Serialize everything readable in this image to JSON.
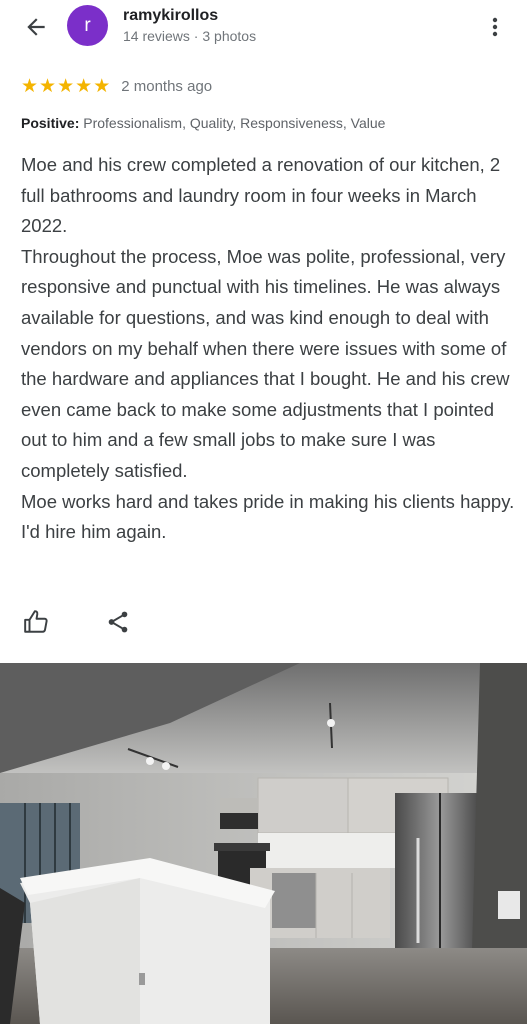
{
  "user": {
    "avatar_letter": "r",
    "name": "ramykirollos",
    "meta": "14 reviews · 3 photos"
  },
  "review": {
    "rating": 5,
    "max_rating": 5,
    "time_ago": "2 months ago",
    "attributes_label": "Positive:",
    "attributes": "Professionalism, Quality, Responsiveness, Value",
    "paragraphs": [
      "Moe and his crew completed a renovation of our kitchen, 2 full bathrooms and laundry room in four weeks in March 2022.",
      "Throughout the process, Moe was polite, professional, very responsive and punctual with his timelines. He was always available for questions, and was kind enough to deal with vendors on my behalf when there were issues with some of the hardware and appliances that I bought. He and his crew even came back to make some adjustments that I pointed out to him and a few small jobs to make sure I was completely satisfied.",
      "Moe works hard and takes pride in making his clients happy. I'd hire him again."
    ]
  },
  "icons": {
    "back": "arrow-back-icon",
    "more": "more-vert-icon",
    "star": "star-icon",
    "like": "thumb-up-icon",
    "share": "share-icon"
  },
  "colors": {
    "avatar": "#7b2fc9",
    "star": "#f4b400"
  }
}
